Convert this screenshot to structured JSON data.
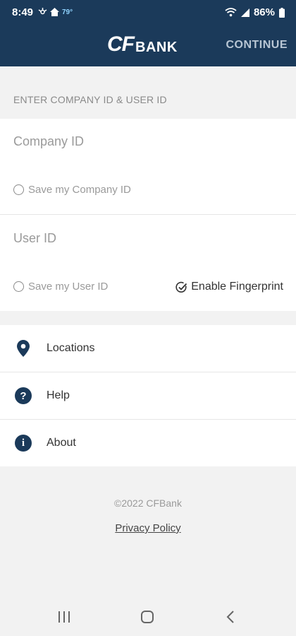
{
  "status_bar": {
    "time": "8:49",
    "temperature": "79°",
    "battery": "86%"
  },
  "header": {
    "logo_mark": "CF",
    "logo_bank": "BANK",
    "continue_label": "CONTINUE"
  },
  "login": {
    "section_label": "ENTER COMPANY ID & USER ID",
    "company_id_placeholder": "Company ID",
    "save_company_id_label": "Save my Company ID",
    "user_id_placeholder": "User ID",
    "save_user_id_label": "Save my User ID",
    "enable_fingerprint_label": "Enable Fingerprint"
  },
  "menu": {
    "items": [
      {
        "label": "Locations",
        "icon": "location-pin-icon"
      },
      {
        "label": "Help",
        "icon": "help-icon"
      },
      {
        "label": "About",
        "icon": "info-icon"
      }
    ]
  },
  "footer": {
    "copyright": "©2022 CFBank",
    "privacy_policy": "Privacy Policy"
  },
  "colors": {
    "brand_navy": "#1b3a5a",
    "background": "#f2f2f2"
  }
}
